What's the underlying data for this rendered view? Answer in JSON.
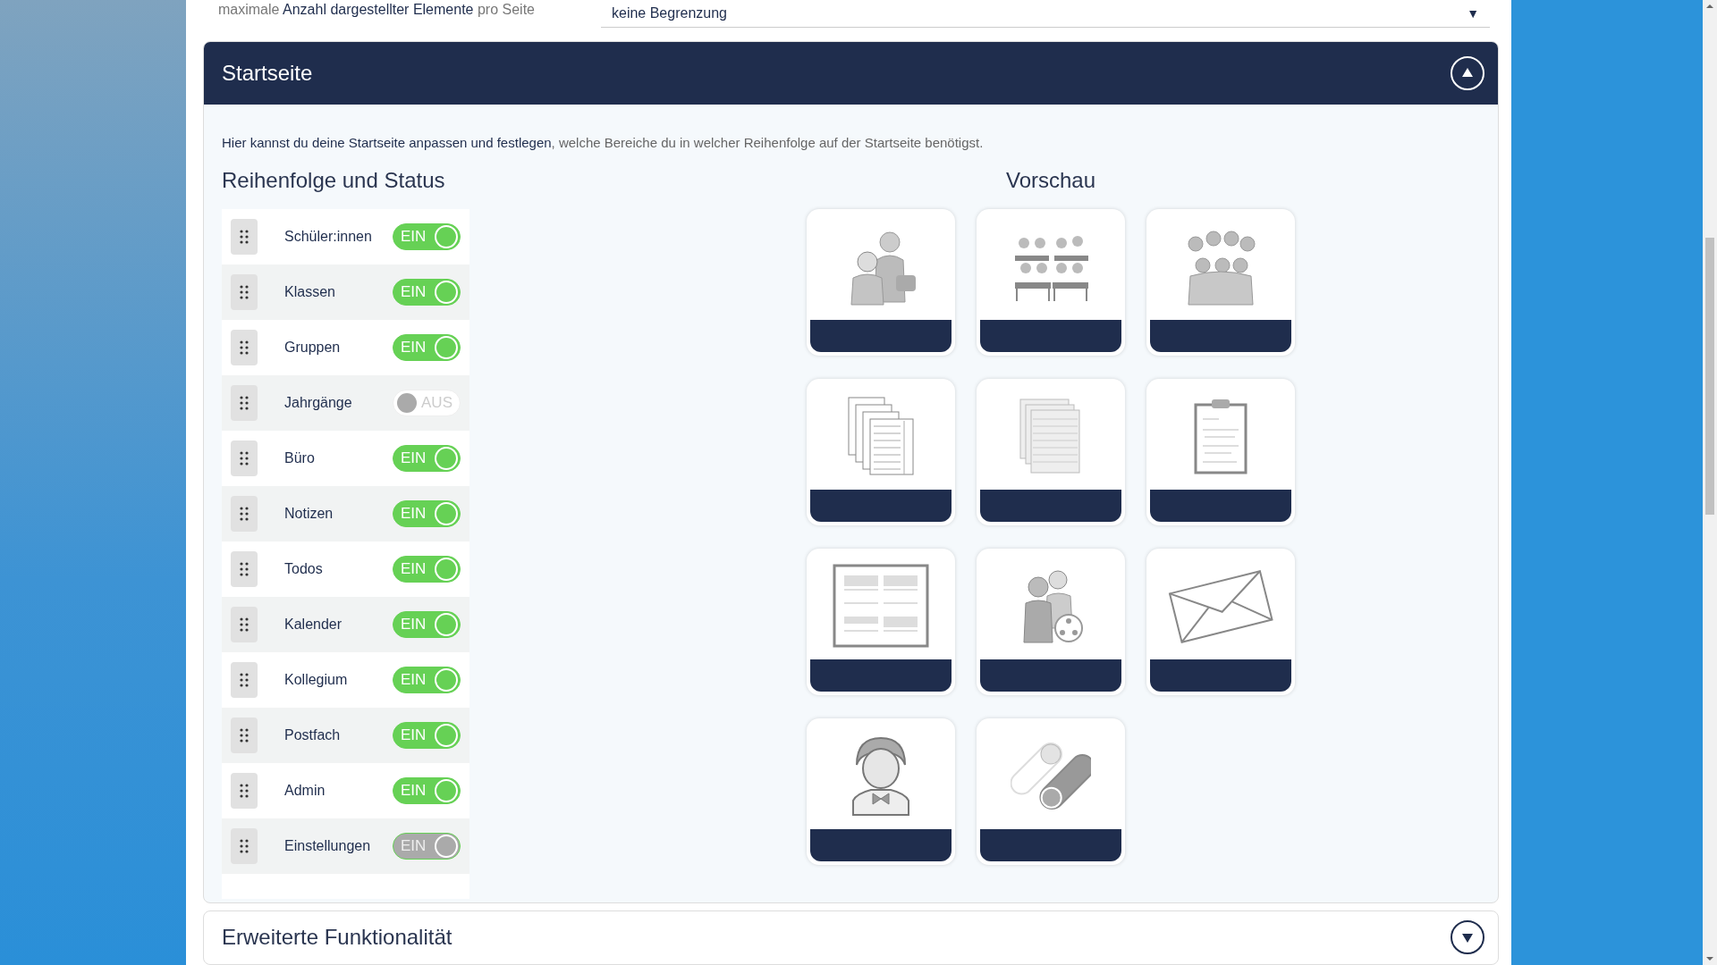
{
  "page_limit": {
    "label": "maximale **Anzahl dargestellter Elemente** pro Seite",
    "value": "keine Begrenzung",
    "arrow": "▼"
  },
  "startseite": {
    "title": "Startseite",
    "expanded": true,
    "description": "**Hier kannst du deine Startseite anpassen und festlegen**, welche Bereiche du in welcher Reihenfolge auf der Startseite benötigst.",
    "order_heading": "Reihenfolge und Status",
    "preview_heading": "Vorschau",
    "items": [
      {
        "label": "Schüler:innen",
        "on": true,
        "disabled": false,
        "toggle_label": "EIN"
      },
      {
        "label": "Klassen",
        "on": true,
        "disabled": false,
        "toggle_label": "EIN"
      },
      {
        "label": "Gruppen",
        "on": true,
        "disabled": false,
        "toggle_label": "EIN"
      },
      {
        "label": "Jahrgänge",
        "on": false,
        "disabled": false,
        "toggle_label": "AUS"
      },
      {
        "label": "Büro",
        "on": true,
        "disabled": false,
        "toggle_label": "EIN"
      },
      {
        "label": "Notizen",
        "on": true,
        "disabled": false,
        "toggle_label": "EIN"
      },
      {
        "label": "Todos",
        "on": true,
        "disabled": false,
        "toggle_label": "EIN"
      },
      {
        "label": "Kalender",
        "on": true,
        "disabled": false,
        "toggle_label": "EIN"
      },
      {
        "label": "Kollegium",
        "on": true,
        "disabled": false,
        "toggle_label": "EIN"
      },
      {
        "label": "Postfach",
        "on": true,
        "disabled": false,
        "toggle_label": "EIN"
      },
      {
        "label": "Admin",
        "on": true,
        "disabled": false,
        "toggle_label": "EIN"
      },
      {
        "label": "Einstellungen",
        "on": true,
        "disabled": true,
        "toggle_label": "EIN"
      }
    ],
    "preview_cards": [
      {
        "kind": "pair"
      },
      {
        "kind": "classroom"
      },
      {
        "kind": "group"
      },
      {
        "kind": "lists"
      },
      {
        "kind": "notes"
      },
      {
        "kind": "todo"
      },
      {
        "kind": "calendar"
      },
      {
        "kind": "colleagues"
      },
      {
        "kind": "mail"
      },
      {
        "kind": "admin"
      },
      {
        "kind": "settings"
      }
    ]
  },
  "extended": {
    "title": "Erweiterte Funktionalität",
    "expanded": false
  }
}
